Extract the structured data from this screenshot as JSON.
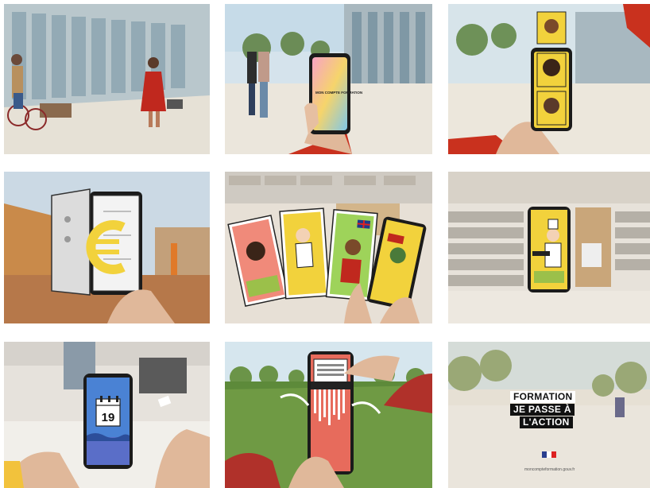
{
  "grid": {
    "tiles": [
      {
        "id": 1
      },
      {
        "id": 2,
        "phone_text": "MON COMPTE FORMATION"
      },
      {
        "id": 3
      },
      {
        "id": 4
      },
      {
        "id": 5
      },
      {
        "id": 6
      },
      {
        "id": 7,
        "calendar_day": "19"
      },
      {
        "id": 8
      },
      {
        "id": 9,
        "line1": "FORMATION",
        "line2": "JE PASSE À",
        "line3": "L'ACTION",
        "url": "moncompteformation.gouv.fr"
      }
    ]
  },
  "colors": {
    "sky": "#c9dbe6",
    "pavement": "#e8e4dc",
    "grass": "#5d8a3a",
    "phone": "#1b1b1b",
    "illustration_yellow": "#f2d23c",
    "illustration_red": "#e86a5a",
    "calendar_blue": "#3f78c8",
    "banner_black": "#111111"
  },
  "icons": [
    "euro-icon",
    "calendar-icon",
    "flag-icon",
    "uk-flag-icon"
  ]
}
